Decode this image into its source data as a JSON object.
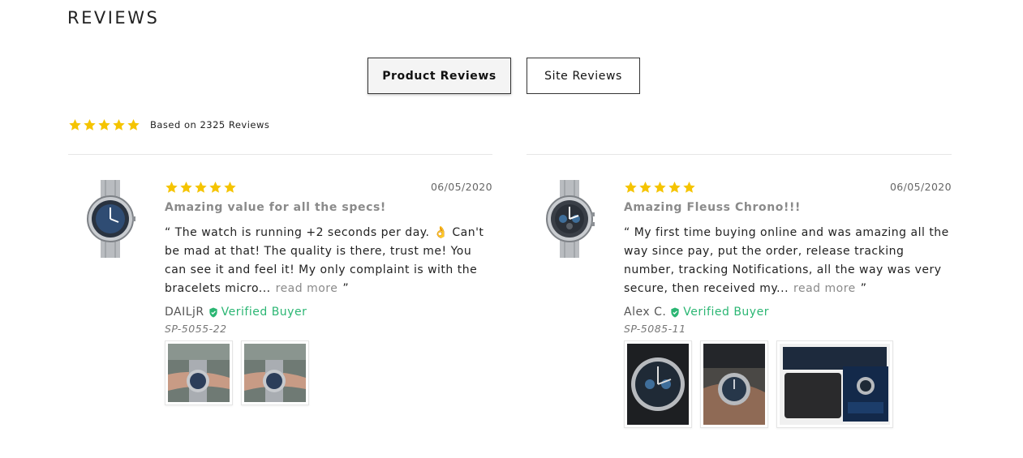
{
  "title": "REVIEWS",
  "tabs": {
    "product": "Product Reviews",
    "site": "Site Reviews"
  },
  "summary": {
    "rating": 5,
    "text": "Based on 2325 Reviews"
  },
  "colors": {
    "star": "#f5c400",
    "verified": "#2bb673"
  },
  "reviews": [
    {
      "rating": 5,
      "date": "06/05/2020",
      "title": "Amazing value for all the specs!",
      "content": "“ The watch is running +2 seconds per day. 👌 Can't be mad at that! The quality is there, trust me! You can see it and feel it! My only complaint is with the bracelets micro...",
      "read_more": "read more",
      "close_quote": "”",
      "author": "DAILjR",
      "verified": "Verified Buyer",
      "sku": "SP-5055-22"
    },
    {
      "rating": 5,
      "date": "06/05/2020",
      "title": "Amazing Fleuss Chrono!!!",
      "content": "“ My first time buying online and was amazing all the way since pay, put the order, release tracking number, tracking Notifications, all the way was very secure, then received my...",
      "read_more": "read more",
      "close_quote": "”",
      "author": "Alex C.",
      "verified": "Verified Buyer",
      "sku": "SP-5085-11"
    }
  ]
}
